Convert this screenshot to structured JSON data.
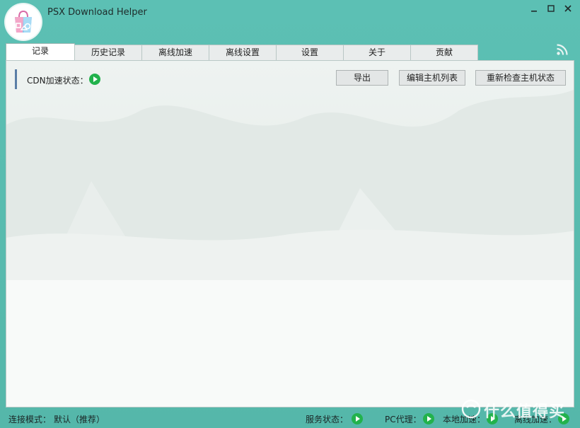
{
  "window": {
    "title": "PSX Download Helper",
    "minimize_icon": "minimize-icon",
    "maximize_icon": "maximize-icon",
    "close_icon": "close-icon"
  },
  "tabs": [
    {
      "label": "记录",
      "active": true
    },
    {
      "label": "历史记录",
      "active": false
    },
    {
      "label": "离线加速",
      "active": false
    },
    {
      "label": "离线设置",
      "active": false
    },
    {
      "label": "设置",
      "active": false
    },
    {
      "label": "关于",
      "active": false
    },
    {
      "label": "贡献",
      "active": false
    }
  ],
  "header_icon": "rss-icon",
  "main": {
    "cdn_status_label": "CDN加速状态：",
    "buttons": {
      "export": "导出",
      "edit_host_list": "编辑主机列表",
      "recheck_host_status": "重新检查主机状态"
    }
  },
  "statusbar": {
    "connection_mode_label": "连接模式：",
    "connection_mode_value": "默认（推荐）",
    "service_status_label": "服务状态：",
    "pc_proxy_label": "PC代理：",
    "local_accel_label": "本地加速：",
    "offline_accel_label": "离线加速："
  },
  "watermark": {
    "text": "什么值得买"
  },
  "colors": {
    "window_bg": "#5cc0b4",
    "status_green": "#22b24c",
    "accent_bar": "#5a7ea6"
  }
}
